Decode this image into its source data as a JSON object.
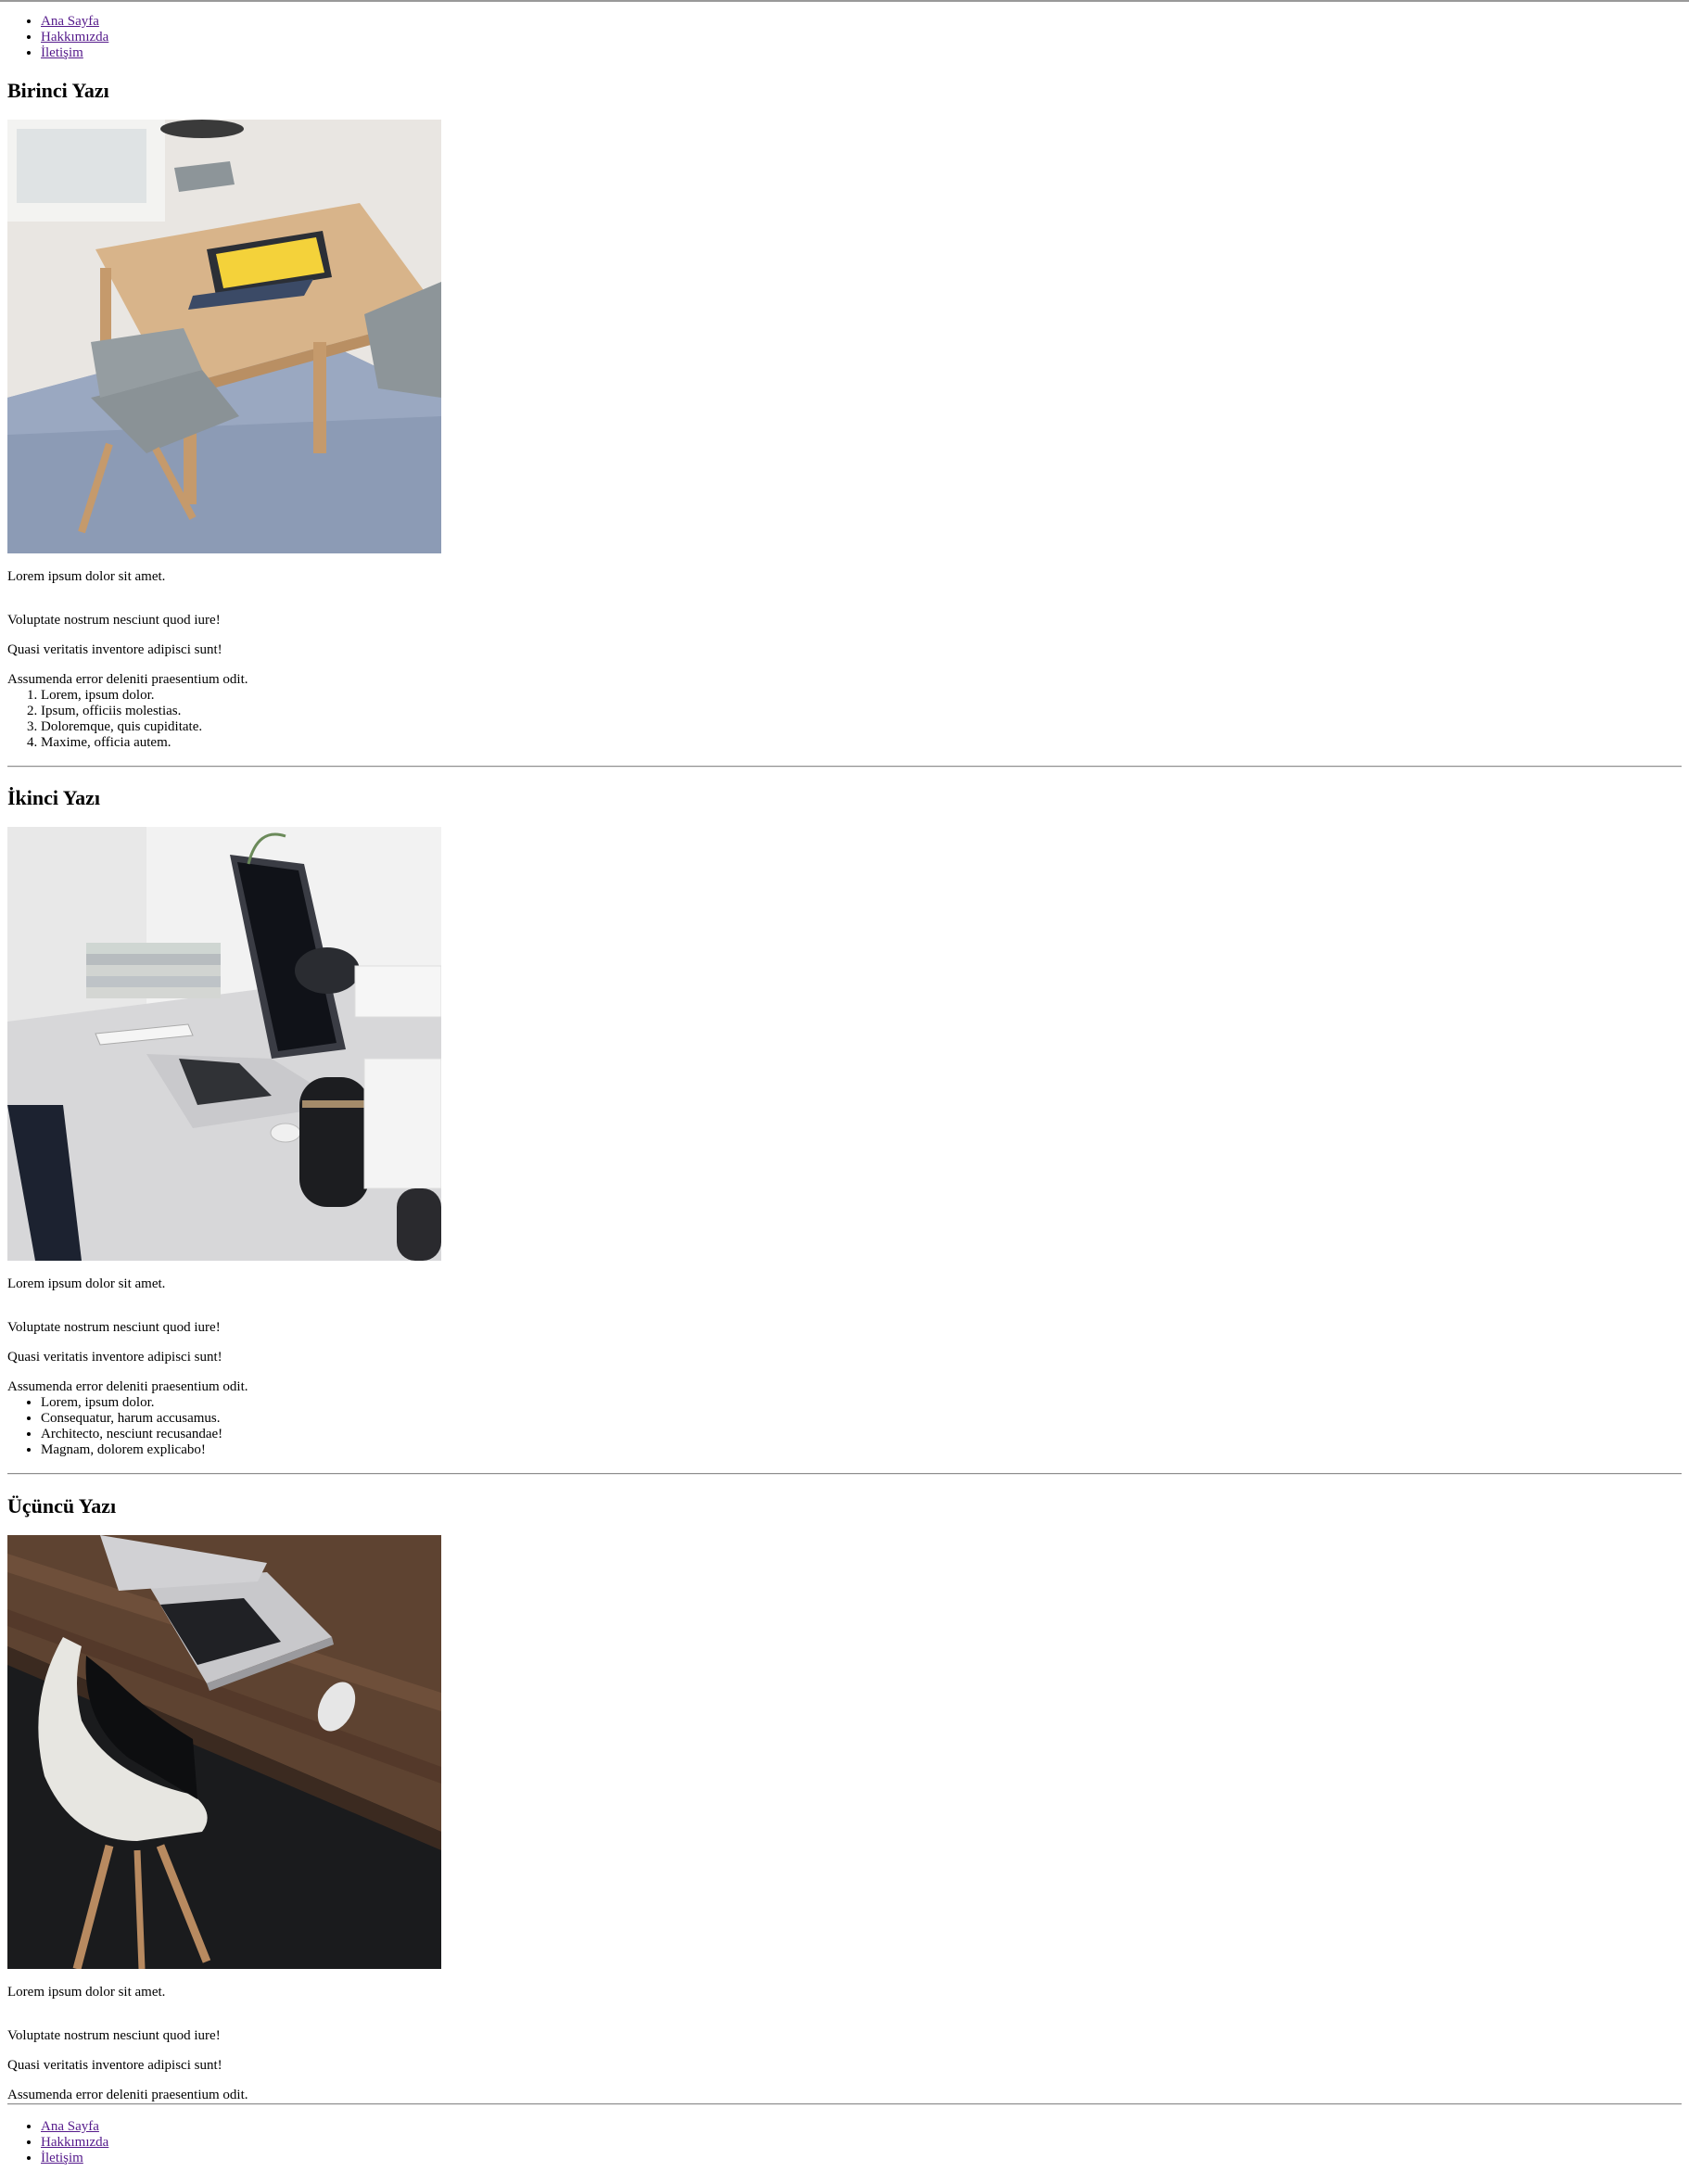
{
  "nav": {
    "items": [
      {
        "label": "Ana Sayfa"
      },
      {
        "label": "Hakkımızda"
      },
      {
        "label": "İletişim"
      }
    ]
  },
  "posts": [
    {
      "title": "Birinci Yazı",
      "image_description": "",
      "paragraphs": [
        "Lorem ipsum dolor sit amet.",
        "Voluptate nostrum nesciunt quod iure!",
        "Quasi veritatis inventore adipisci sunt!",
        "Assumenda error deleniti praesentium odit."
      ],
      "list_type": "ordered",
      "list": [
        "Lorem, ipsum dolor.",
        "Ipsum, officiis molestias.",
        "Doloremque, quis cupiditate.",
        "Maxime, officia autem."
      ]
    },
    {
      "title": "İkinci Yazı",
      "paragraphs": [
        "Lorem ipsum dolor sit amet.",
        "Voluptate nostrum nesciunt quod iure!",
        "Quasi veritatis inventore adipisci sunt!",
        "Assumenda error deleniti praesentium odit."
      ],
      "list_type": "unordered",
      "list": [
        "Lorem, ipsum dolor.",
        "Consequatur, harum accusamus.",
        "Architecto, nesciunt recusandae!",
        "Magnam, dolorem explicabo!"
      ]
    },
    {
      "title": "Üçüncü Yazı",
      "paragraphs": [
        "Lorem ipsum dolor sit amet.",
        "Voluptate nostrum nesciunt quod iure!",
        "Quasi veritatis inventore adipisci sunt!",
        "Assumenda error deleniti praesentium odit."
      ]
    }
  ],
  "footer_nav": {
    "items": [
      {
        "label": "Ana Sayfa"
      },
      {
        "label": "Hakkımızda"
      },
      {
        "label": "İletişim"
      }
    ]
  },
  "colors": {
    "link": "#551a8b",
    "text": "#000000",
    "rule": "#8f8f8f"
  }
}
